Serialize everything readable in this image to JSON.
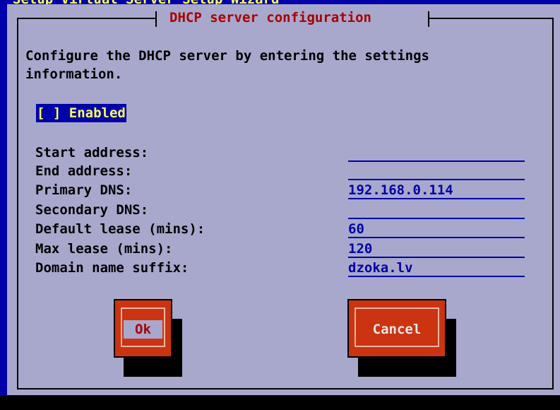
{
  "background_title": "Setup Virtual Server Setup Wizard",
  "dialog": {
    "title": "DHCP server configuration",
    "description": "Configure the DHCP server by entering the settings\ninformation."
  },
  "enabled_checkbox": {
    "label": "[ ] Enabled",
    "checked": false
  },
  "fields": [
    {
      "label": "Start address:",
      "value": ""
    },
    {
      "label": "End address:",
      "value": ""
    },
    {
      "label": "Primary DNS:",
      "value": "192.168.0.114"
    },
    {
      "label": "Secondary DNS:",
      "value": ""
    },
    {
      "label": "Default lease (mins):",
      "value": "60"
    },
    {
      "label": "Max lease (mins):",
      "value": "120"
    },
    {
      "label": "Domain name suffix:",
      "value": "dzoka.lv"
    }
  ],
  "buttons": {
    "ok": "Ok",
    "cancel": "Cancel"
  },
  "colors": {
    "screen_bg": "#0000aa",
    "dialog_bg": "#a8a8cc",
    "title": "#aa0000",
    "highlight_bg": "#0000aa",
    "highlight_fg": "#ffff55",
    "field": "#0000aa",
    "button": "#cc3311"
  }
}
